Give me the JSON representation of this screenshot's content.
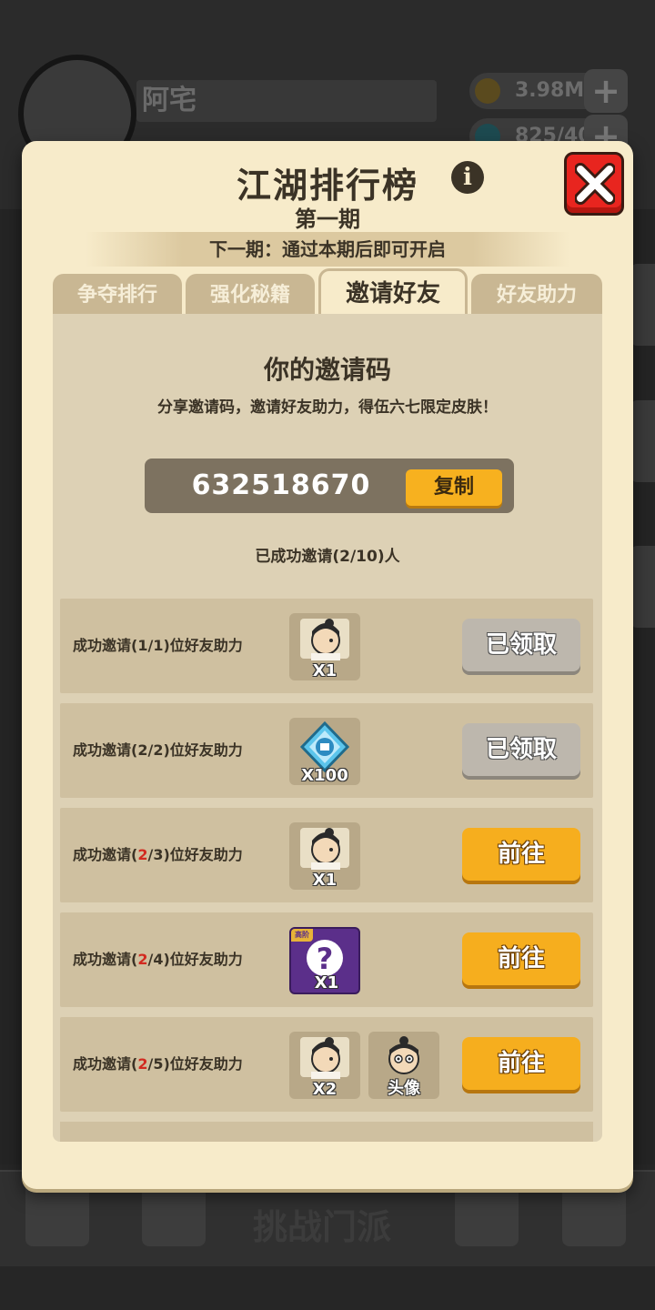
{
  "background": {
    "player_name": "阿宅",
    "coins": "3.98M",
    "gems": "825/40",
    "plus_glyph": "+",
    "bottom_center_label": "挑战门派"
  },
  "modal": {
    "title": "江湖排行榜",
    "subtitle": "第一期",
    "next_period": "下一期：通过本期后即可开启",
    "info_glyph": "i",
    "tabs": [
      {
        "label": "争夺排行"
      },
      {
        "label": "强化秘籍"
      },
      {
        "label": "邀请好友"
      },
      {
        "label": "好友助力"
      }
    ],
    "active_tab": 2
  },
  "invite": {
    "title": "你的邀请码",
    "description": "分享邀请码，邀请好友助力，得伍六七限定皮肤！",
    "code": "632518670",
    "copy_label": "复制",
    "invited_count": "已成功邀请(2/10)人"
  },
  "rewards": [
    {
      "prefix": "成功邀请(",
      "done": "1",
      "sep": "/",
      "need": "1",
      "suffix": ")位好友助力",
      "item": "character-card",
      "qty": "X1",
      "button": "已领取",
      "state": "claimed"
    },
    {
      "prefix": "成功邀请(",
      "done": "2",
      "sep": "/",
      "need": "2",
      "suffix": ")位好友助力",
      "item": "multiplier-diamond",
      "qty": "X100",
      "button": "已领取",
      "state": "claimed"
    },
    {
      "prefix": "成功邀请(",
      "done": "2",
      "sep": "/",
      "need": "3",
      "suffix": ")位好友助力",
      "item": "character-card",
      "qty": "X1",
      "button": "前往",
      "state": "go"
    },
    {
      "prefix": "成功邀请(",
      "done": "2",
      "sep": "/",
      "need": "4",
      "suffix": ")位好友助力",
      "item": "mystery-box",
      "tag": "高阶",
      "qty": "X1",
      "button": "前往",
      "state": "go"
    },
    {
      "prefix": "成功邀请(",
      "done": "2",
      "sep": "/",
      "need": "5",
      "suffix": ")位好友助力",
      "item": "character-card",
      "qty": "X2",
      "item2": "avatar-frame",
      "qty2": "头像",
      "button": "前往",
      "state": "go"
    }
  ],
  "colors": {
    "modal_bg": "#f7ebca",
    "panel_bg": "#ddd1b5",
    "row_bg": "#cfc0a0",
    "go_button": "#f6ae1e",
    "claimed_button": "#bdb7ad",
    "close_button": "#e8251f",
    "highlight_text": "#d22a20"
  }
}
